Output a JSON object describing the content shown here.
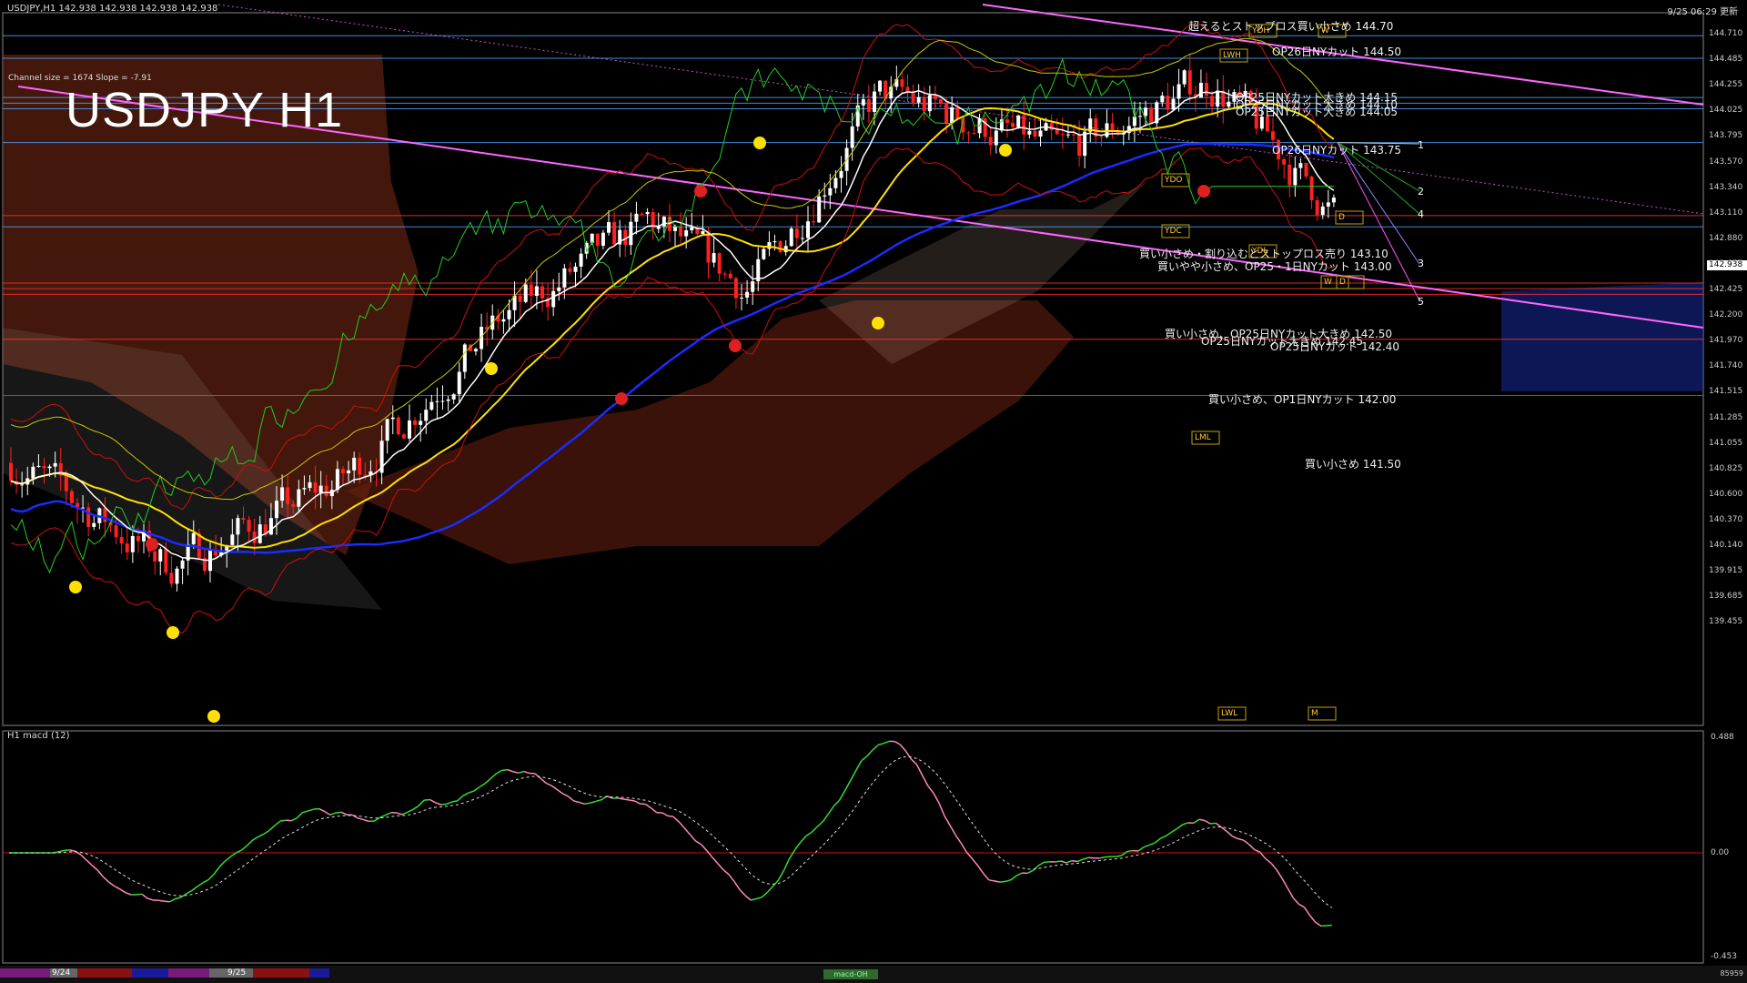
{
  "header": {
    "symbol_line": "USDJPY,H1  142.938 142.938 142.938 142.938",
    "datetime": "9/25 06:29 更新",
    "big_title": "USDJPY H1",
    "channel_info": "Channel size = 1674 Slope = -7.91"
  },
  "price_axis": [
    "144.710",
    "144.485",
    "144.255",
    "144.025",
    "143.795",
    "143.570",
    "143.340",
    "143.110",
    "142.880",
    "142.655",
    "142.425",
    "142.200",
    "141.970",
    "141.740",
    "141.515",
    "141.285",
    "141.055",
    "140.825",
    "140.600",
    "140.370",
    "140.140",
    "139.915",
    "139.685",
    "139.455"
  ],
  "current_price": "142.938",
  "levels": [
    {
      "text": "超えるとストップロス買い小さめ 144.70",
      "color": "#4aa3ff"
    },
    {
      "text": "OP26日NYカット 144.50",
      "color": "#4aa3ff"
    },
    {
      "text": "OP25日NYカット大きめ 144.15",
      "color": "#4aa3ff"
    },
    {
      "text": "OP25日NYカット大きめ 144.10",
      "color": "#4aa3ff"
    },
    {
      "text": "OP25日NYカット大きめ 144.05",
      "color": "#4aa3ff"
    },
    {
      "text": "OP26日NYカット 143.75",
      "color": "#4aa3ff"
    },
    {
      "text": "買い小さめ・割り込むとストップロス売り 143.10",
      "color": "#ff3030"
    },
    {
      "text": "買いやや小さめ、OP25・1日NYカット 143.00",
      "color": "#4aa3ff"
    },
    {
      "text": "買い小さめ、OP25日NYカット大きめ 142.50",
      "color": "#ff3030"
    },
    {
      "text": "OP25日NYカット大きめ 142.45",
      "color": "#ff3030"
    },
    {
      "text": "OP25日NYカット 142.40",
      "color": "#ff3030"
    },
    {
      "text": "買い小さめ、OP1日NYカット 142.00",
      "color": "#ff3030"
    },
    {
      "text": "買い小さめ 141.50",
      "color": "#ff3030"
    }
  ],
  "projection_numbers": [
    "1",
    "2",
    "3",
    "4",
    "5"
  ],
  "box_tags": [
    "YDH",
    "W",
    "LWH",
    "YDO",
    "YDC",
    "YDL",
    "W",
    "D",
    "LWL",
    "M",
    "LML",
    "D"
  ],
  "macd": {
    "title": "H1  macd (12)",
    "axis": [
      "0.488",
      "0.00",
      "-0.453"
    ]
  },
  "bottom_bar": {
    "dates": [
      "9/24",
      "9/25"
    ],
    "tab_label": "macd-OH",
    "right_text": "85959"
  },
  "colors": {
    "background": "#000000",
    "up_candle": "#ffffff",
    "down_candle": "#ff2020",
    "ma_white": "#ffffff",
    "ma_yellow": "#ffe000",
    "ma_blue": "#1a2cff",
    "chikou_green": "#22cc22",
    "bollinger_red": "#cc1010",
    "channel_pink": "#ff66ff",
    "macd_green": "#33dd33",
    "macd_pink": "#ff88bb"
  }
}
